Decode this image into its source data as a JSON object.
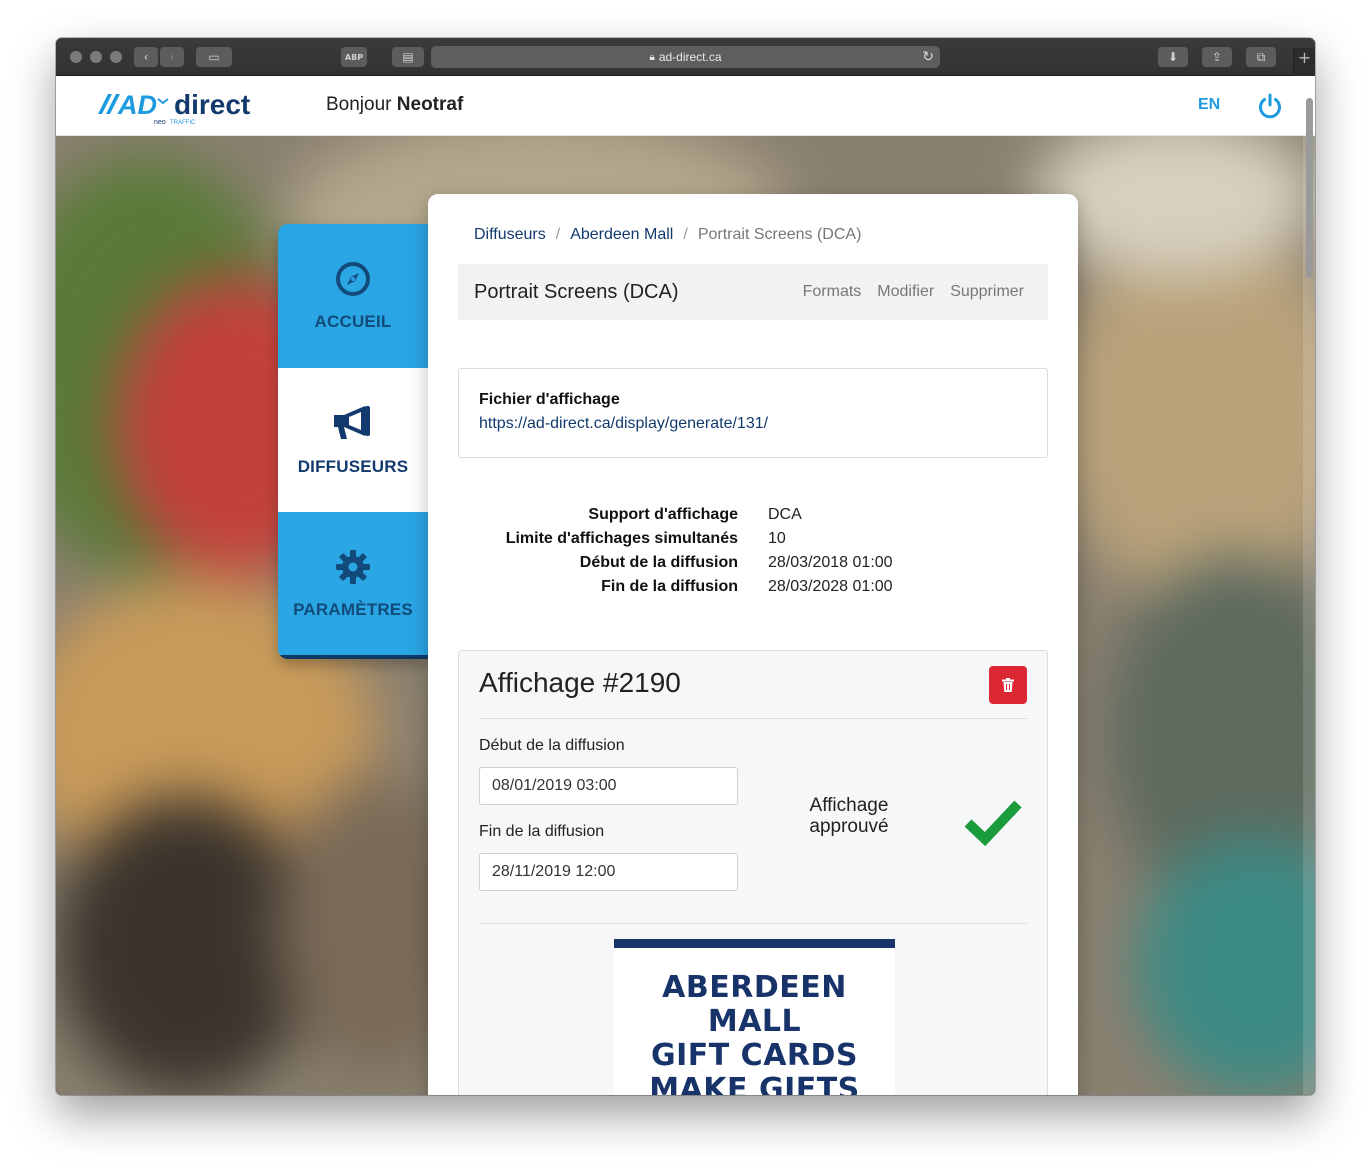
{
  "browser": {
    "url": "ad-direct.ca",
    "adblock_label": "ABP"
  },
  "header": {
    "logo_text": "AD-direct",
    "logo_sub": "neo TRAFFIC",
    "greeting_prefix": "Bonjour",
    "greeting_name": "Neotraf",
    "language": "EN"
  },
  "sidebar": {
    "items": [
      {
        "label": "ACCUEIL",
        "icon": "compass-icon",
        "active": false
      },
      {
        "label": "DIFFUSEURS",
        "icon": "megaphone-icon",
        "active": true
      },
      {
        "label": "PARAMÈTRES",
        "icon": "gear-icon",
        "active": false
      }
    ]
  },
  "breadcrumb": {
    "items": [
      "Diffuseurs",
      "Aberdeen Mall",
      "Portrait Screens (DCA)"
    ],
    "separator": "/"
  },
  "title_box": {
    "title": "Portrait Screens (DCA)",
    "actions": [
      "Formats",
      "Modifier",
      "Supprimer"
    ]
  },
  "display_file": {
    "heading": "Fichier d'affichage",
    "url": "https://ad-direct.ca/display/generate/131/"
  },
  "specs": [
    {
      "key": "Support d'affichage",
      "value": "DCA"
    },
    {
      "key": "Limite d'affichages simultanés",
      "value": "10"
    },
    {
      "key": "Début de la diffusion",
      "value": "28/03/2018 01:00"
    },
    {
      "key": "Fin de la diffusion",
      "value": "28/03/2028 01:00"
    }
  ],
  "affichage": {
    "title": "Affichage #2190",
    "start_label": "Début de la diffusion",
    "start_value": "08/01/2019 03:00",
    "end_label": "Fin de la diffusion",
    "end_value": "28/11/2019 12:00",
    "status": "Affichage approuvé",
    "poster_text": "ABERDEEN MALL\nGIFT CARDS\nMAKE GIFTS\nEASIER"
  },
  "colors": {
    "brand_blue": "#2aa6e4",
    "navy": "#123a6e",
    "danger": "#dc2834",
    "success": "#1a9b3c"
  }
}
